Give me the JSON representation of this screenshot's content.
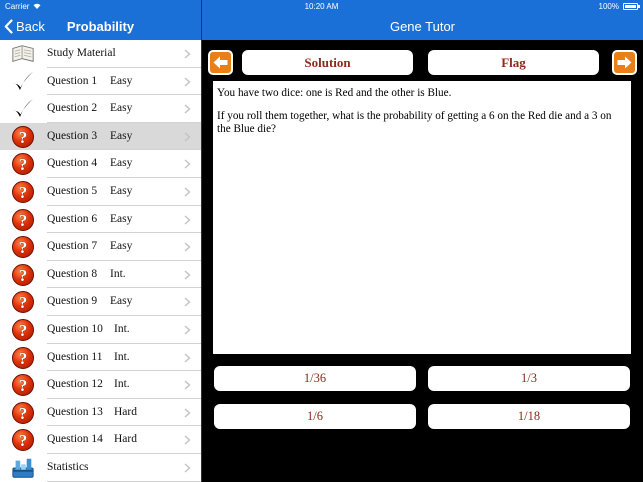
{
  "status": {
    "carrier": "Carrier",
    "time": "10:20 AM",
    "battery": "100%"
  },
  "left_nav": {
    "back_label": "Back",
    "title": "Probability"
  },
  "right_nav": {
    "title": "Gene Tutor"
  },
  "sidebar": {
    "items": [
      {
        "label": "Study Material",
        "level": "",
        "icon": "book-icon"
      },
      {
        "label": "Question 1",
        "level": "Easy",
        "icon": "checkmark-icon"
      },
      {
        "label": "Question 2",
        "level": "Easy",
        "icon": "checkmark-icon"
      },
      {
        "label": "Question 3",
        "level": "Easy",
        "icon": "question-mark-icon"
      },
      {
        "label": "Question 4",
        "level": "Easy",
        "icon": "question-mark-icon"
      },
      {
        "label": "Question 5",
        "level": "Easy",
        "icon": "question-mark-icon"
      },
      {
        "label": "Question 6",
        "level": "Easy",
        "icon": "question-mark-icon"
      },
      {
        "label": "Question 7",
        "level": "Easy",
        "icon": "question-mark-icon"
      },
      {
        "label": "Question 8",
        "level": "Int.",
        "icon": "question-mark-icon"
      },
      {
        "label": "Question 9",
        "level": "Easy",
        "icon": "question-mark-icon"
      },
      {
        "label": "Question 10",
        "level": "Int.",
        "icon": "question-mark-icon"
      },
      {
        "label": "Question 11",
        "level": "Int.",
        "icon": "question-mark-icon"
      },
      {
        "label": "Question 12",
        "level": "Int.",
        "icon": "question-mark-icon"
      },
      {
        "label": "Question 13",
        "level": "Hard",
        "icon": "question-mark-icon"
      },
      {
        "label": "Question 14",
        "level": "Hard",
        "icon": "question-mark-icon"
      },
      {
        "label": "Statistics",
        "level": "",
        "icon": "statistics-icon"
      }
    ],
    "selected_index": 3
  },
  "toolbar": {
    "solution_label": "Solution",
    "flag_label": "Flag"
  },
  "question": {
    "line1": "You have two dice: one is Red and the other is Blue.",
    "line2": "If you roll them together, what is the probability of getting a 6 on the Red die and a 3 on the Blue die?"
  },
  "answers": [
    "1/36",
    "1/3",
    "1/6",
    "1/18"
  ],
  "colors": {
    "bar_blue": "#1a70d6",
    "accent_orange": "#e87f18",
    "answer_text": "#8b2c1a"
  }
}
